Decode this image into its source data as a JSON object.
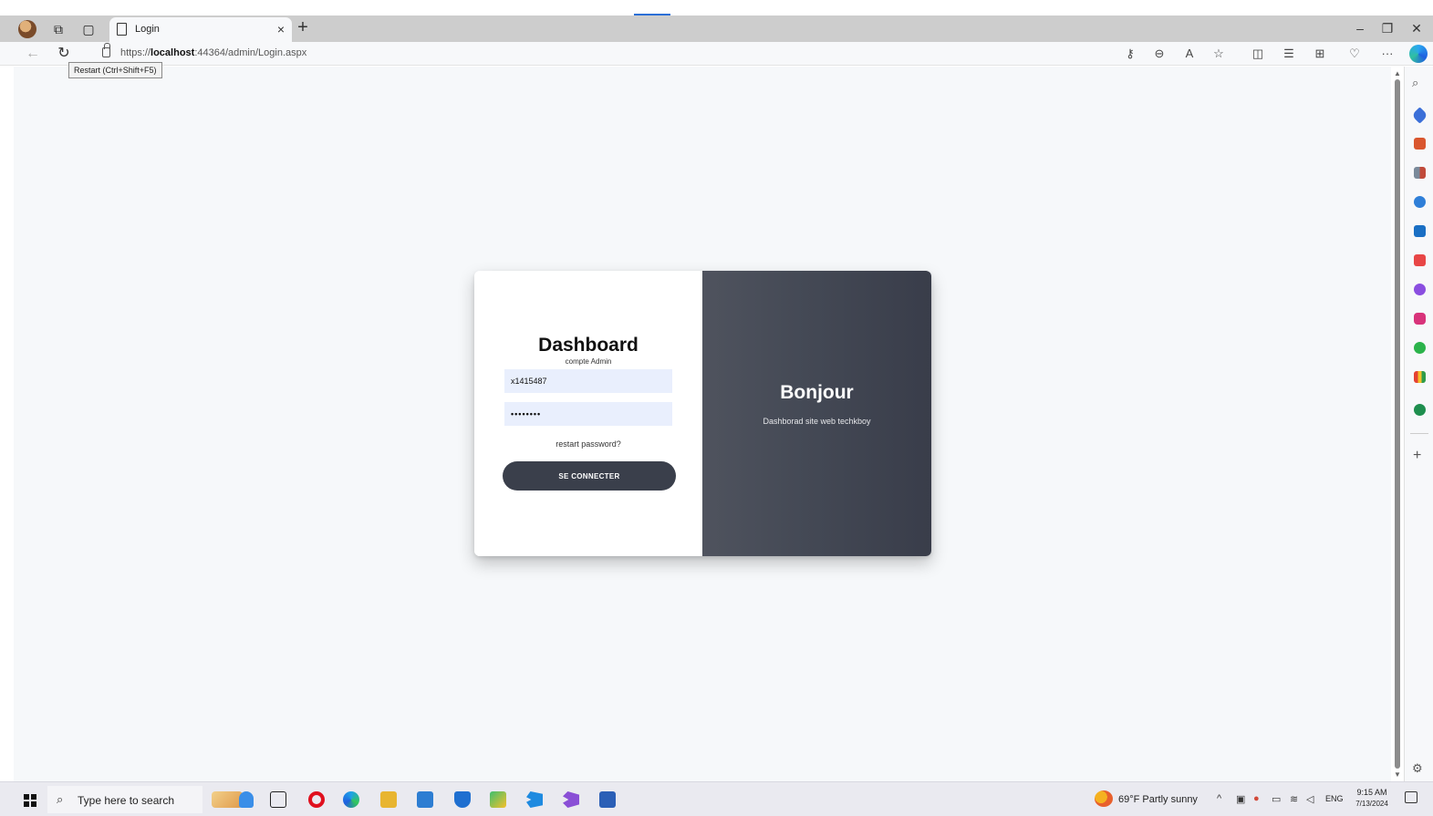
{
  "browser": {
    "tab": {
      "title": "Login",
      "close": "×"
    },
    "new_tab": "+",
    "url_prefix": "https://",
    "url_host": "localhost",
    "url_rest": ":44364/admin/Login.aspx",
    "tooltip": "Restart (Ctrl+Shift+F5)",
    "more": "···"
  },
  "login": {
    "title": "Dashboard",
    "subtitle": "compte Admin",
    "username_value": "x1415487",
    "password_value": "••••••••",
    "forgot_link": "restart password?",
    "submit_label": "SE CONNECTER"
  },
  "welcome": {
    "title": "Bonjour",
    "text": "Dashborad site web techkboy"
  },
  "taskbar": {
    "search_placeholder": "Type here to search",
    "weather": "69°F  Partly sunny",
    "language": "ENG",
    "time": "9:15 AM",
    "date": "7/13/2024"
  },
  "colors": {
    "page_bg": "#f6f8fa",
    "welcome_panel": "#444955",
    "input_bg": "#e9effd",
    "button_bg": "#3a3f4b"
  }
}
